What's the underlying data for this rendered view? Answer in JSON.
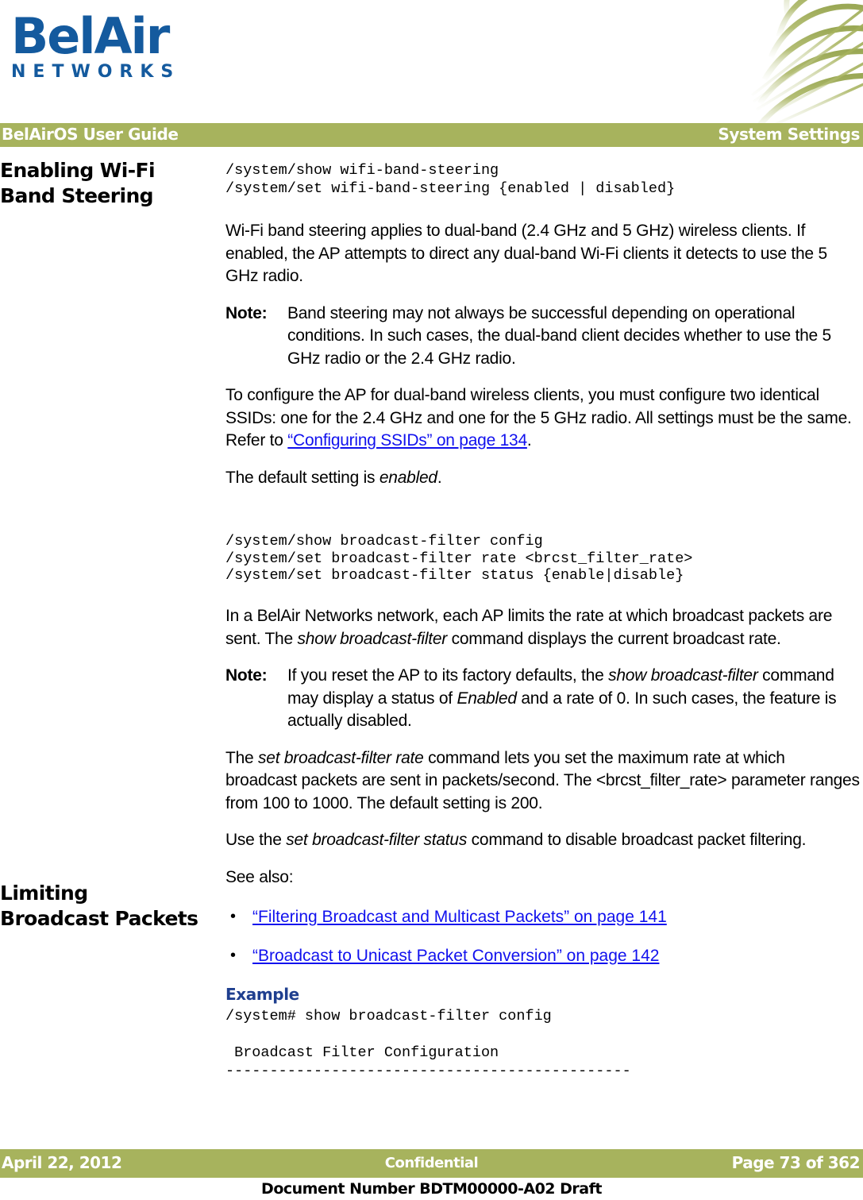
{
  "header": {
    "logo_word": "BelAir",
    "logo_sub": "NETWORKS",
    "logo_color": "#145a9e",
    "band_color": "#a7b35d",
    "band_left": "BelAirOS User Guide",
    "band_right": "System Settings",
    "graphic_name": "radial-web-graphic"
  },
  "sections": [
    {
      "heading_line1": "Enabling Wi-Fi",
      "heading_line2": "Band Steering",
      "cli": "/system/show wifi-band-steering\n/system/set wifi-band-steering {enabled | disabled}",
      "para1": "Wi-Fi band steering applies to dual-band (2.4 GHz and 5 GHz) wireless clients. If enabled, the AP attempts to direct any dual-band Wi-Fi clients it detects to use the 5 GHz radio.",
      "note_label": "Note:",
      "note_text": "Band steering may not always be successful depending on operational conditions. In such cases, the dual-band client decides whether to use the 5 GHz radio or the 2.4 GHz radio.",
      "para2_before": "To configure the AP for dual-band wireless clients, you must configure two identical SSIDs: one for the 2.4 GHz and one for the 5 GHz radio. All settings must be the same. Refer to ",
      "para2_link": "“Configuring SSIDs” on page 134",
      "para2_after": ".",
      "para3_before": "The default setting is ",
      "para3_italic": "enabled",
      "para3_after": "."
    },
    {
      "heading_line1": "Limiting",
      "heading_line2": "Broadcast Packets",
      "cli_line1": "/system/show broadcast-filter config",
      "cli_rest": "/system/set broadcast-filter rate <brcst_filter_rate>\n/system/set broadcast-filter status {enable|disable}",
      "para1_before": "In a BelAir Networks network, each AP limits the rate at which broadcast packets are sent. The ",
      "para1_italic": "show broadcast-filter",
      "para1_after": " command displays the current broadcast rate.",
      "note_label": "Note:",
      "note_text_a": "If you reset the AP to its factory defaults, the ",
      "note_italic_a": "show broadcast-filter",
      "note_text_b": " command may display a status of ",
      "note_italic_b": "Enabled",
      "note_text_c": " and a rate of 0. In such cases, the feature is actually disabled.",
      "para2_before": "The ",
      "para2_italic": "set broadcast-filter rate",
      "para2_after": " command lets you set the maximum rate at which broadcast packets are sent in packets/second. The <brcst_filter_rate> parameter ranges from 100 to 1000. The default setting is 200.",
      "para3_before": "Use the ",
      "para3_italic": "set broadcast-filter status",
      "para3_after": " command to disable broadcast packet filtering.",
      "see_also_label": "See also:",
      "see_also_links": [
        "“Filtering Broadcast and Multicast Packets” on page 141",
        "“Broadcast to Unicast Packet Conversion” on page 142"
      ],
      "bullet_glyph": "•",
      "example_heading": "Example",
      "example_color": "#1f3f8f",
      "example_output": "/system# show broadcast-filter config\n\n Broadcast Filter Configuration\n----------------------------------------------"
    }
  ],
  "link_color": "#1111ee",
  "footer": {
    "date": "April 22, 2012",
    "center": "Confidential",
    "page": "Page 73 of 362",
    "document_number": "Document Number BDTM00000-A02 Draft",
    "band_color": "#a7b35d"
  }
}
